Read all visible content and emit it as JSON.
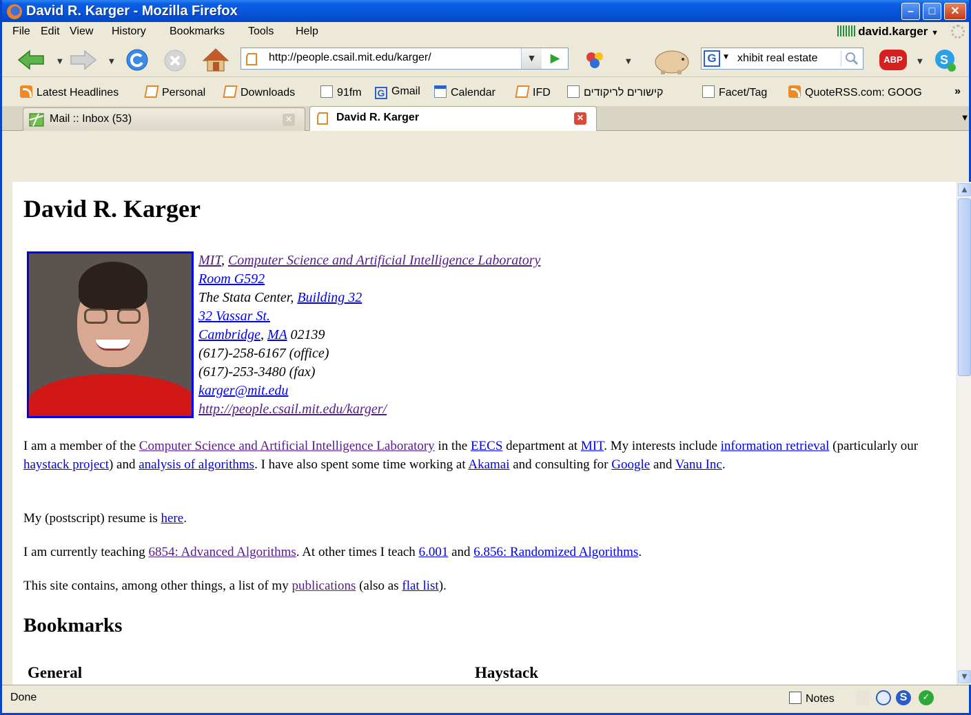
{
  "window": {
    "title": "David R. Karger - Mozilla Firefox"
  },
  "menu": {
    "file": "File",
    "edit": "Edit",
    "view": "View",
    "history": "History",
    "bookmarks": "Bookmarks",
    "tools": "Tools",
    "help": "Help",
    "account": "david.karger"
  },
  "nav": {
    "url": "http://people.csail.mit.edu/karger/",
    "search_value": "xhibit real estate",
    "abp_label": "ABP"
  },
  "bookmarks_bar": {
    "items": [
      {
        "label": "Latest Headlines",
        "icon": "rss-icon"
      },
      {
        "label": "Personal",
        "icon": "folder-icon"
      },
      {
        "label": "Downloads",
        "icon": "folder-icon"
      },
      {
        "label": "91fm",
        "icon": "page-icon"
      },
      {
        "label": "Gmail",
        "icon": "google-icon"
      },
      {
        "label": "Calendar",
        "icon": "calendar-icon"
      },
      {
        "label": "IFD",
        "icon": "folder-icon"
      },
      {
        "label": "קישורים לריקודים",
        "icon": "page-icon"
      },
      {
        "label": "Facet/Tag",
        "icon": "page-icon"
      },
      {
        "label": "QuoteRSS.com: GOOG",
        "icon": "rss-icon"
      }
    ],
    "more": "»"
  },
  "tabs": [
    {
      "label": "Mail :: Inbox (53)",
      "active": false
    },
    {
      "label": "David R. Karger",
      "active": true
    }
  ],
  "page": {
    "name": "David R. Karger",
    "address": {
      "mit": "MIT",
      "csail": "Computer Science and Artificial Intelligence Laboratory",
      "room": "Room G592",
      "stata_prefix": "The Stata Center, ",
      "building": "Building 32",
      "street": "32 Vassar St.",
      "cambridge": "Cambridge",
      "ma": "MA",
      "zip": " 02139",
      "office": "(617)-258-6167 (office)",
      "fax": "(617)-253-3480 (fax)",
      "email": "karger@mit.edu",
      "homepage": "http://people.csail.mit.edu/karger/"
    },
    "p1": {
      "t1": "I am a member of the ",
      "l1": "Computer Science and Artificial Intelligence Laboratory",
      "t2": " in the ",
      "l2": "EECS",
      "t3": " department at ",
      "l3": "MIT",
      "t4": ". My interests include ",
      "l4": "information retrieval",
      "t5": " (particularly our ",
      "l5": "haystack project",
      "t6": ") and ",
      "l6": "analysis of algorithms",
      "t7": ". I have also spent some time working at ",
      "l7": "Akamai",
      "t8": " and consulting for ",
      "l8": "Google",
      "t9": " and ",
      "l9": "Vanu Inc",
      "t10": "."
    },
    "p2": {
      "t1": "My (postscript) resume is ",
      "l1": "here",
      "t2": "."
    },
    "p3": {
      "t1": "I am currently teaching ",
      "l1": "6854: Advanced Algorithms",
      "t2": ". At other times I teach ",
      "l2": "6.001",
      "t3": " and ",
      "l3": "6.856: Randomized Algorithms",
      "t4": "."
    },
    "p4": {
      "t1": "This site contains, among other things, a list of my ",
      "l1": "publications",
      "t2": " (also as ",
      "l2": "flat list",
      "t3": ")."
    },
    "bookmarks_heading": "Bookmarks",
    "col_general": "General",
    "col_haystack": "Haystack"
  },
  "status": {
    "text": "Done",
    "notes": "Notes"
  }
}
